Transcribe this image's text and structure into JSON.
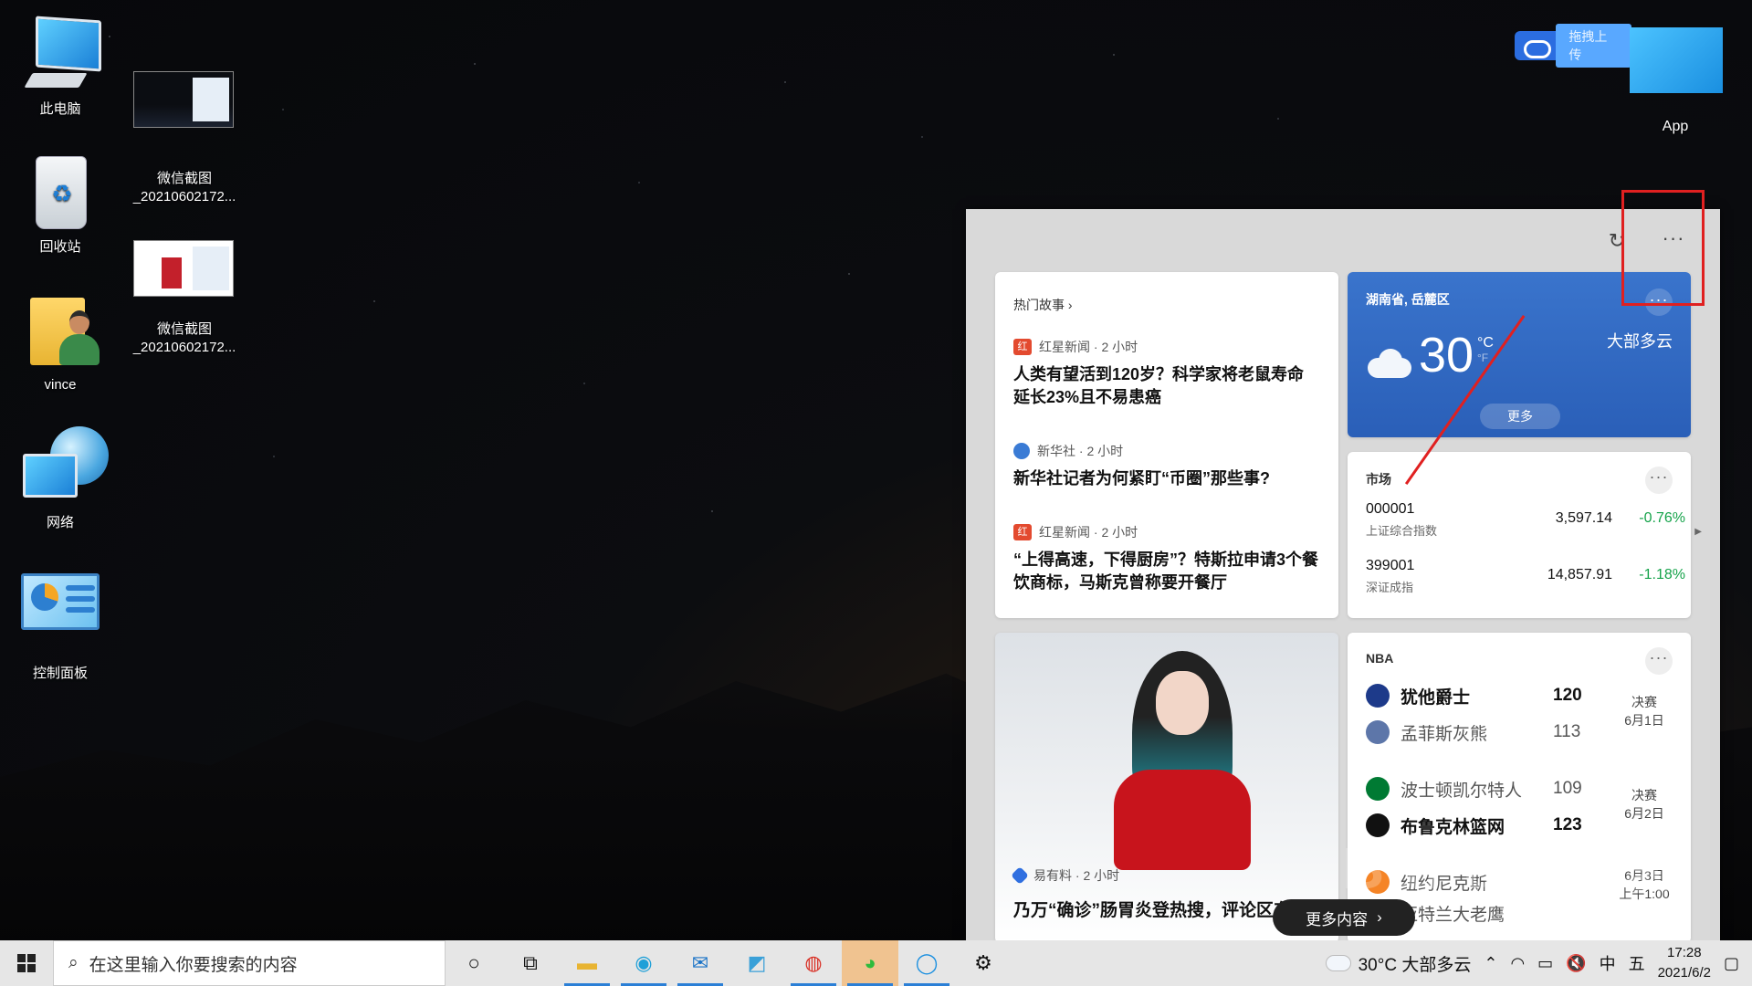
{
  "desktop": {
    "icons": [
      {
        "label": "此电脑"
      },
      {
        "label": "回收站"
      },
      {
        "label": "vince"
      },
      {
        "label": "网络"
      },
      {
        "label": "控制面板"
      },
      {
        "label": "微信截图\n_20210602172..."
      },
      {
        "label": "微信截图\n_20210602172..."
      }
    ],
    "upload_label": "拖拽上传",
    "app_label": "App"
  },
  "news": {
    "hot": {
      "header": "热门故事 ›",
      "stories": [
        {
          "source": "红星新闻 · 2 小时",
          "logo": "红",
          "title": "人类有望活到120岁？科学家将老鼠寿命延长23%且不易患癌"
        },
        {
          "source": "新华社 · 2 小时",
          "logo": "",
          "title": "新华社记者为何紧盯“币圈”那些事?"
        },
        {
          "source": "红星新闻 · 2 小时",
          "logo": "红",
          "title": "“上得高速，下得厨房”？特斯拉申请3个餐饮商标，马斯克曾称要开餐厅"
        }
      ]
    },
    "weather": {
      "location": "湖南省, 岳麓区",
      "temp": "30",
      "unit_c": "°C",
      "unit_f": "°F",
      "condition": "大部多云",
      "more": "更多"
    },
    "market": {
      "header": "市场",
      "rows": [
        {
          "code": "000001",
          "name": "上证综合指数",
          "value": "3,597.14",
          "change": "-0.76%"
        },
        {
          "code": "399001",
          "name": "深证成指",
          "value": "14,857.91",
          "change": "-1.18%"
        }
      ]
    },
    "image_story": {
      "source": "易有料 · 2 小时",
      "title": "乃万“确诊”肠胃炎登热搜，评论区东”"
    },
    "nba": {
      "header": "NBA",
      "games": [
        {
          "teams": [
            {
              "name": "犹他爵士",
              "score": "120",
              "win": true,
              "color": "#1d3a8a"
            },
            {
              "name": "孟菲斯灰熊",
              "score": "113",
              "win": false,
              "color": "#5d76a9"
            }
          ],
          "status": "决赛",
          "date": "6月1日"
        },
        {
          "teams": [
            {
              "name": "波士顿凯尔特人",
              "score": "109",
              "win": false,
              "color": "#007a33"
            },
            {
              "name": "布鲁克林篮网",
              "score": "123",
              "win": true,
              "color": "#111111"
            }
          ],
          "status": "决赛",
          "date": "6月2日"
        }
      ],
      "partial": {
        "name": "纽约尼克斯",
        "next": "亚特兰大老鹰",
        "date": "6月3日",
        "time": "上午1:00"
      }
    },
    "more_content": "更多内容"
  },
  "taskbar": {
    "search_placeholder": "在这里输入你要搜索的内容",
    "weather": "30°C  大部多云",
    "ime": "中",
    "ime2": "五",
    "time": "17:28",
    "date": "2021/6/2"
  }
}
